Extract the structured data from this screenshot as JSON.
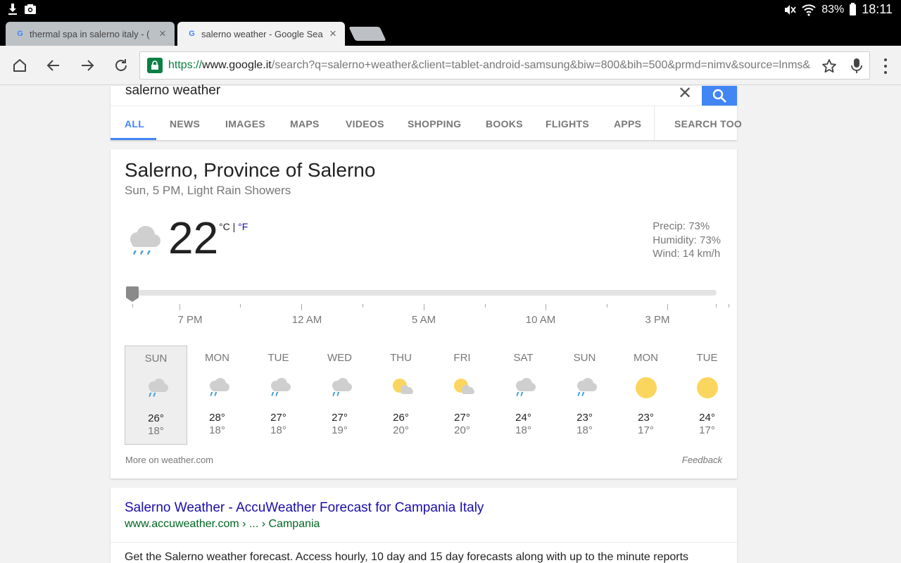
{
  "status_bar": {
    "battery": "83%",
    "time": "18:11",
    "left_icons": [
      "download-icon",
      "screenshot-icon"
    ],
    "right_icons": [
      "mute-icon",
      "wifi-icon",
      "battery-icon"
    ]
  },
  "browser": {
    "tabs": [
      {
        "title": "thermal spa in salerno italy - (",
        "active": false
      },
      {
        "title": "salerno weather - Google Sea",
        "active": true
      }
    ],
    "url": {
      "scheme": "https://",
      "host": "www.google.it",
      "path": "/search?q=salerno+weather&client=tablet-android-samsung&biw=800&bih=500&prmd=nimv&source=lnms&"
    }
  },
  "search": {
    "query": "salerno weather",
    "tabs": [
      "ALL",
      "NEWS",
      "IMAGES",
      "MAPS",
      "VIDEOS",
      "SHOPPING",
      "BOOKS",
      "FLIGHTS",
      "APPS",
      "SEARCH TOO"
    ],
    "active_tab": "ALL",
    "accent_color": "#4285f4"
  },
  "weather": {
    "location": "Salerno, Province of Salerno",
    "condition": "Sun, 5 PM, Light Rain Showers",
    "temperature": "22",
    "unit_c": "°C",
    "unit_sep": "|",
    "unit_f": "°F",
    "precip": "Precip: 73%",
    "humidity": "Humidity: 73%",
    "wind": "Wind: 14 km/h",
    "current_icon": "rain-cloud-icon",
    "time_labels": [
      "7 PM",
      "12 AM",
      "5 AM",
      "10 AM",
      "3 PM"
    ],
    "days": [
      {
        "name": "SUN",
        "high": "26°",
        "low": "18°",
        "icon": "rain-showers-icon",
        "selected": true
      },
      {
        "name": "MON",
        "high": "28°",
        "low": "18°",
        "icon": "rain-showers-icon"
      },
      {
        "name": "TUE",
        "high": "27°",
        "low": "18°",
        "icon": "rain-showers-icon"
      },
      {
        "name": "WED",
        "high": "27°",
        "low": "19°",
        "icon": "rain-showers-icon"
      },
      {
        "name": "THU",
        "high": "26°",
        "low": "20°",
        "icon": "partly-cloudy-icon"
      },
      {
        "name": "FRI",
        "high": "27°",
        "low": "20°",
        "icon": "partly-cloudy-icon"
      },
      {
        "name": "SAT",
        "high": "24°",
        "low": "18°",
        "icon": "rain-showers-icon"
      },
      {
        "name": "SUN",
        "high": "23°",
        "low": "18°",
        "icon": "rain-showers-icon"
      },
      {
        "name": "MON",
        "high": "23°",
        "low": "17°",
        "icon": "sunny-icon"
      },
      {
        "name": "TUE",
        "high": "24°",
        "low": "17°",
        "icon": "sunny-icon"
      }
    ],
    "more_link": "More on weather.com",
    "feedback": "Feedback"
  },
  "result": {
    "title": "Salerno Weather - AccuWeather Forecast for Campania Italy",
    "url": "www.accuweather.com › ... › Campania",
    "snippet": "Get the Salerno weather forecast. Access hourly, 10 day and 15 day forecasts along with up to the minute reports"
  }
}
